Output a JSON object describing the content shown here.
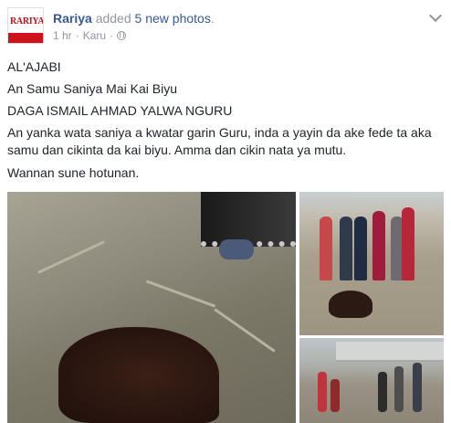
{
  "post": {
    "page_name": "Rariya",
    "action_prefix": "added",
    "action_link": "5 new photos",
    "action_suffix": ".",
    "time": "1 hr",
    "separator": "·",
    "location": "Karu",
    "separator2": "·",
    "avatar_logo": "RARIYA",
    "body": [
      "AL'AJABI",
      "An Samu Saniya Mai Kai Biyu",
      "DAGA ISMAIL AHMAD YALWA NGURU",
      "An yanka wata saniya a kwatar garin Guru, inda a yayin da ake fede ta aka samu dan cikinta da kai biyu. Amma dan cikin nata ya mutu.",
      "Wannan sune hotunan."
    ],
    "icons": {
      "privacy": "globe-icon",
      "options": "chevron-down-icon"
    },
    "colors": {
      "link": "#365899",
      "meta": "#90949c",
      "text": "#1d2129",
      "brand_red": "#d0121a"
    }
  }
}
